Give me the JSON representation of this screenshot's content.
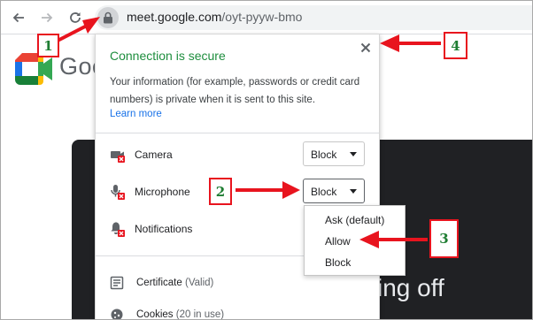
{
  "browser": {
    "url_host": "meet.google.com",
    "url_path": "/oyt-pyyw-bmo",
    "icons": [
      "back-arrow-icon",
      "forward-arrow-icon",
      "reload-icon",
      "lock-icon"
    ]
  },
  "page": {
    "brand": "Goo",
    "video_text": "ing off"
  },
  "site_info": {
    "title": "Connection is secure",
    "description": "Your information (for example, passwords or credit card numbers) is private when it is sent to this site.",
    "learn_more": "Learn more",
    "permissions": [
      {
        "label": "Camera",
        "value": "Block",
        "icon": "camera-blocked-icon"
      },
      {
        "label": "Microphone",
        "value": "Block",
        "icon": "microphone-blocked-icon"
      },
      {
        "label": "Notifications",
        "icon": "notifications-blocked-icon"
      }
    ],
    "certificate": {
      "label": "Certificate",
      "status": "(Valid)"
    },
    "cookies": {
      "label": "Cookies",
      "status": "(20 in use)"
    }
  },
  "dropdown": {
    "options": [
      "Ask (default)",
      "Allow",
      "Block"
    ]
  },
  "annotations": {
    "step1": "1",
    "step2": "2",
    "step3": "3",
    "step4": "4",
    "color": "#e8141e",
    "number_color": "#1e7d32"
  },
  "colors": {
    "secure_green": "#1e8e3e",
    "link_blue": "#1a73e8",
    "video_bg": "#202124"
  }
}
